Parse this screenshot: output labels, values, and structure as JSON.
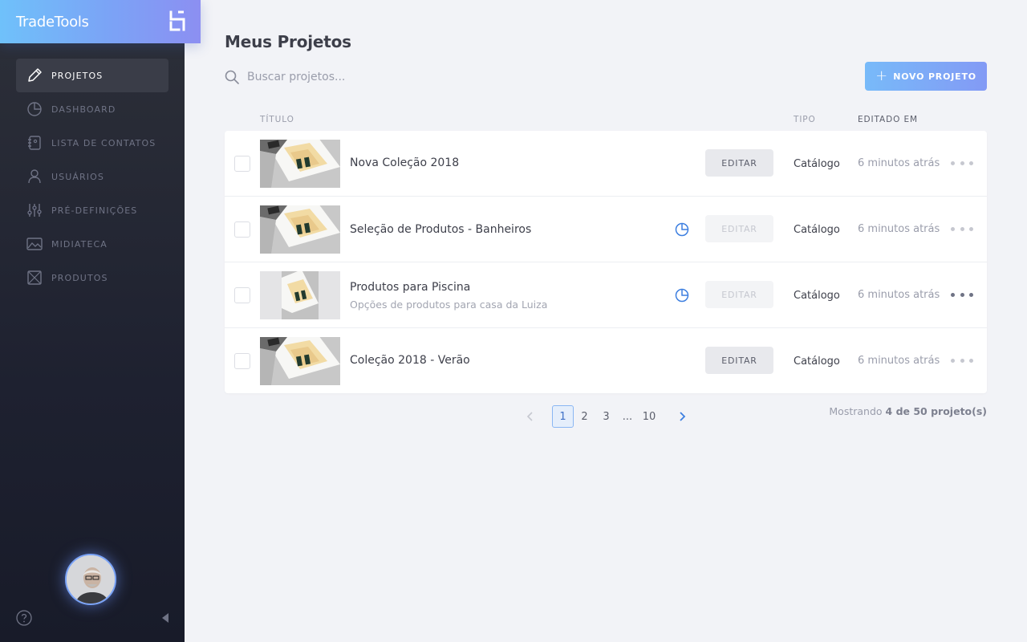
{
  "app": {
    "name": "TradeTools"
  },
  "sidebar": {
    "items": [
      {
        "label": "PROJETOS",
        "icon": "pencil-icon",
        "active": true
      },
      {
        "label": "DASHBOARD",
        "icon": "pie-chart-icon"
      },
      {
        "label": "LISTA DE CONTATOS",
        "icon": "address-book-icon"
      },
      {
        "label": "USUÁRIOS",
        "icon": "user-icon"
      },
      {
        "label": "PRÉ-DEFINIÇÕES",
        "icon": "sliders-icon"
      },
      {
        "label": "MIDIATECA",
        "icon": "image-icon"
      },
      {
        "label": "PRODUTOS",
        "icon": "box-icon"
      }
    ],
    "help_icon": "help-icon",
    "collapse_icon": "collapse-arrow-icon"
  },
  "page": {
    "title": "Meus Projetos"
  },
  "search": {
    "placeholder": "Buscar projetos...",
    "value": ""
  },
  "new_project_button": {
    "label": "NOVO PROJETO"
  },
  "table": {
    "columns": {
      "title": "TÍTULO",
      "type": "TIPO",
      "edited": "EDITADO EM"
    },
    "rows": [
      {
        "title": "Nova Coleção 2018",
        "subtitle": "",
        "edit_label": "EDITAR",
        "edit_enabled": true,
        "processing": false,
        "type": "Catálogo",
        "edited": "6 minutos atrás"
      },
      {
        "title": "Seleção de Produtos - Banheiros",
        "subtitle": "",
        "edit_label": "EDITAR",
        "edit_enabled": false,
        "processing": true,
        "type": "Catálogo",
        "edited": "6 minutos atrás"
      },
      {
        "title": "Produtos para Piscina",
        "subtitle": "Opções de produtos para casa da Luiza",
        "edit_label": "EDITAR",
        "edit_enabled": false,
        "processing": true,
        "type": "Catálogo",
        "edited": "6 minutos atrás"
      },
      {
        "title": "Coleção 2018 - Verão",
        "subtitle": "",
        "edit_label": "EDITAR",
        "edit_enabled": true,
        "processing": false,
        "type": "Catálogo",
        "edited": "6 minutos atrás"
      }
    ]
  },
  "pagination": {
    "pages": [
      "1",
      "2",
      "3"
    ],
    "ellipsis": "...",
    "last": "10",
    "current": "1"
  },
  "showing": {
    "prefix": "Mostrando",
    "count": "4 de 50 projeto(s)"
  },
  "colors": {
    "accent": "#7aa3f7",
    "processing_icon": "#3d7fe0",
    "sidebar_bg": "#1e2130"
  }
}
